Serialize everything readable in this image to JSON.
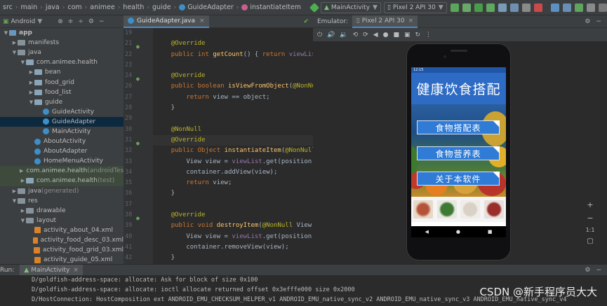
{
  "navbar": {
    "breadcrumbs": [
      "src",
      "main",
      "java",
      "com",
      "animee",
      "health",
      "guide",
      "GuideAdapter",
      "instantiateItem"
    ],
    "run_config": "MainActivity",
    "device": "Pixel 2 API 30"
  },
  "project": {
    "view_label": "Android",
    "tree": [
      {
        "label": "app",
        "depth": 0,
        "kind": "module"
      },
      {
        "label": "manifests",
        "depth": 1,
        "kind": "folder"
      },
      {
        "label": "java",
        "depth": 1,
        "kind": "folder"
      },
      {
        "label": "com.animee.health",
        "depth": 2,
        "kind": "package"
      },
      {
        "label": "bean",
        "depth": 3,
        "kind": "package"
      },
      {
        "label": "food_grid",
        "depth": 3,
        "kind": "package"
      },
      {
        "label": "food_list",
        "depth": 3,
        "kind": "package"
      },
      {
        "label": "guide",
        "depth": 3,
        "kind": "package"
      },
      {
        "label": "GuideActivity",
        "depth": 4,
        "kind": "class"
      },
      {
        "label": "GuideAdapter",
        "depth": 4,
        "kind": "class",
        "selected": true
      },
      {
        "label": "MainActivity",
        "depth": 4,
        "kind": "class"
      },
      {
        "label": "AboutActivity",
        "depth": 3,
        "kind": "class"
      },
      {
        "label": "AboutAdapter",
        "depth": 3,
        "kind": "class"
      },
      {
        "label": "HomeMenuActivity",
        "depth": 3,
        "kind": "class"
      },
      {
        "label": "com.animee.health",
        "suffix": "(androidTest)",
        "depth": 2,
        "kind": "package",
        "highlight": true
      },
      {
        "label": "com.animee.health",
        "suffix": "(test)",
        "depth": 2,
        "kind": "package",
        "highlight": true
      },
      {
        "label": "java",
        "suffix": "(generated)",
        "depth": 1,
        "kind": "folder"
      },
      {
        "label": "res",
        "depth": 1,
        "kind": "folder"
      },
      {
        "label": "drawable",
        "depth": 2,
        "kind": "folder"
      },
      {
        "label": "layout",
        "depth": 2,
        "kind": "folder"
      },
      {
        "label": "activity_about_04.xml",
        "depth": 3,
        "kind": "xml"
      },
      {
        "label": "activity_food_desc_03.xml",
        "depth": 3,
        "kind": "xml"
      },
      {
        "label": "activity_food_grid_03.xml",
        "depth": 3,
        "kind": "xml"
      },
      {
        "label": "activity_guide_05.xml",
        "depth": 3,
        "kind": "xml"
      }
    ]
  },
  "editor": {
    "tab_label": "GuideAdapter.java",
    "line_numbers": [
      "19",
      "21",
      "22",
      "23",
      "24",
      "26",
      "27",
      "28",
      "29",
      "30",
      "31",
      "32",
      "33",
      "34",
      "35",
      "36",
      "37",
      "38",
      "39",
      "40",
      "41",
      "42"
    ],
    "lines": [
      "",
      "    @Override",
      "    public int getCount() { return viewList",
      "",
      "    @Override",
      "    public boolean isViewFromObject(@NonNull",
      "        return view == object;",
      "    }",
      "",
      "    @NonNull",
      "    @Override",
      "    public Object instantiateItem(@NonNull",
      "        View view = viewList.get(position",
      "        container.addView(view);",
      "        return view;",
      "    }",
      "",
      "    @Override",
      "    public void destroyItem(@NonNull View",
      "        View view = viewList.get(position",
      "        container.removeView(view);",
      "    }"
    ]
  },
  "emulator": {
    "label": "Emulator:",
    "tab_label": "Pixel 2 API 30",
    "status_time": "12:15",
    "app_title": "健康饮食搭配",
    "menu_buttons": [
      "食物搭配表",
      "食物营养表",
      "关于本软件"
    ],
    "zoom": {
      "plus": "+",
      "minus": "−",
      "ratio": "1:1"
    }
  },
  "run": {
    "label": "Run:",
    "config": "MainActivity",
    "console_lines": [
      "D/goldfish-address-space: allocate: Ask for block of size 0x100",
      "D/goldfish-address-space: allocate: ioctl allocate returned offset 0x3efffe000 size 0x2000",
      "D/HostConnection: HostComposition ext ANDROID_EMU_CHECKSUM_HELPER_v1 ANDROID_EMU_native_sync_v2 ANDROID_EMU_native_sync_v3 ANDROID_EMU_native_sync_v4"
    ]
  },
  "watermark": "CSDN @新手程序员大大",
  "colors": {
    "ide_bg": "#2b2b2b",
    "panel_bg": "#3c3f41",
    "selection": "#0d293e",
    "accent": "#4a88c7",
    "app_blue": "#2d6bc4",
    "keyword": "#cc7832",
    "annotation": "#bbb529",
    "method": "#ffc66d",
    "field": "#9876aa"
  }
}
